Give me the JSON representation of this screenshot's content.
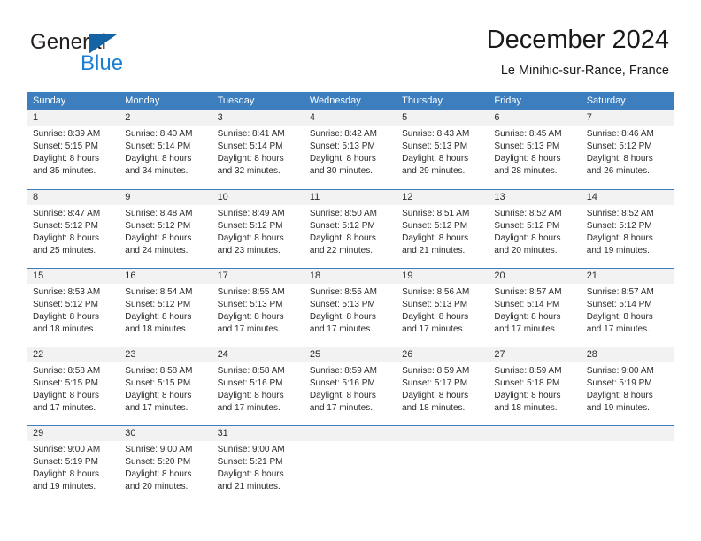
{
  "brand": {
    "word1": "General",
    "word2": "Blue",
    "triangle_color": "#1464a5",
    "word2_color": "#1a7fd4"
  },
  "header": {
    "title": "December 2024",
    "subtitle": "Le Minihic-sur-Rance, France"
  },
  "theme": {
    "header_blue": "#3d7ebe",
    "day_band_gray": "#f2f2f2",
    "text": "#2b2b2b"
  },
  "weekdays": [
    "Sunday",
    "Monday",
    "Tuesday",
    "Wednesday",
    "Thursday",
    "Friday",
    "Saturday"
  ],
  "weeks": [
    [
      {
        "day": "1",
        "lines": [
          "Sunrise: 8:39 AM",
          "Sunset: 5:15 PM",
          "Daylight: 8 hours",
          "and 35 minutes."
        ]
      },
      {
        "day": "2",
        "lines": [
          "Sunrise: 8:40 AM",
          "Sunset: 5:14 PM",
          "Daylight: 8 hours",
          "and 34 minutes."
        ]
      },
      {
        "day": "3",
        "lines": [
          "Sunrise: 8:41 AM",
          "Sunset: 5:14 PM",
          "Daylight: 8 hours",
          "and 32 minutes."
        ]
      },
      {
        "day": "4",
        "lines": [
          "Sunrise: 8:42 AM",
          "Sunset: 5:13 PM",
          "Daylight: 8 hours",
          "and 30 minutes."
        ]
      },
      {
        "day": "5",
        "lines": [
          "Sunrise: 8:43 AM",
          "Sunset: 5:13 PM",
          "Daylight: 8 hours",
          "and 29 minutes."
        ]
      },
      {
        "day": "6",
        "lines": [
          "Sunrise: 8:45 AM",
          "Sunset: 5:13 PM",
          "Daylight: 8 hours",
          "and 28 minutes."
        ]
      },
      {
        "day": "7",
        "lines": [
          "Sunrise: 8:46 AM",
          "Sunset: 5:12 PM",
          "Daylight: 8 hours",
          "and 26 minutes."
        ]
      }
    ],
    [
      {
        "day": "8",
        "lines": [
          "Sunrise: 8:47 AM",
          "Sunset: 5:12 PM",
          "Daylight: 8 hours",
          "and 25 minutes."
        ]
      },
      {
        "day": "9",
        "lines": [
          "Sunrise: 8:48 AM",
          "Sunset: 5:12 PM",
          "Daylight: 8 hours",
          "and 24 minutes."
        ]
      },
      {
        "day": "10",
        "lines": [
          "Sunrise: 8:49 AM",
          "Sunset: 5:12 PM",
          "Daylight: 8 hours",
          "and 23 minutes."
        ]
      },
      {
        "day": "11",
        "lines": [
          "Sunrise: 8:50 AM",
          "Sunset: 5:12 PM",
          "Daylight: 8 hours",
          "and 22 minutes."
        ]
      },
      {
        "day": "12",
        "lines": [
          "Sunrise: 8:51 AM",
          "Sunset: 5:12 PM",
          "Daylight: 8 hours",
          "and 21 minutes."
        ]
      },
      {
        "day": "13",
        "lines": [
          "Sunrise: 8:52 AM",
          "Sunset: 5:12 PM",
          "Daylight: 8 hours",
          "and 20 minutes."
        ]
      },
      {
        "day": "14",
        "lines": [
          "Sunrise: 8:52 AM",
          "Sunset: 5:12 PM",
          "Daylight: 8 hours",
          "and 19 minutes."
        ]
      }
    ],
    [
      {
        "day": "15",
        "lines": [
          "Sunrise: 8:53 AM",
          "Sunset: 5:12 PM",
          "Daylight: 8 hours",
          "and 18 minutes."
        ]
      },
      {
        "day": "16",
        "lines": [
          "Sunrise: 8:54 AM",
          "Sunset: 5:12 PM",
          "Daylight: 8 hours",
          "and 18 minutes."
        ]
      },
      {
        "day": "17",
        "lines": [
          "Sunrise: 8:55 AM",
          "Sunset: 5:13 PM",
          "Daylight: 8 hours",
          "and 17 minutes."
        ]
      },
      {
        "day": "18",
        "lines": [
          "Sunrise: 8:55 AM",
          "Sunset: 5:13 PM",
          "Daylight: 8 hours",
          "and 17 minutes."
        ]
      },
      {
        "day": "19",
        "lines": [
          "Sunrise: 8:56 AM",
          "Sunset: 5:13 PM",
          "Daylight: 8 hours",
          "and 17 minutes."
        ]
      },
      {
        "day": "20",
        "lines": [
          "Sunrise: 8:57 AM",
          "Sunset: 5:14 PM",
          "Daylight: 8 hours",
          "and 17 minutes."
        ]
      },
      {
        "day": "21",
        "lines": [
          "Sunrise: 8:57 AM",
          "Sunset: 5:14 PM",
          "Daylight: 8 hours",
          "and 17 minutes."
        ]
      }
    ],
    [
      {
        "day": "22",
        "lines": [
          "Sunrise: 8:58 AM",
          "Sunset: 5:15 PM",
          "Daylight: 8 hours",
          "and 17 minutes."
        ]
      },
      {
        "day": "23",
        "lines": [
          "Sunrise: 8:58 AM",
          "Sunset: 5:15 PM",
          "Daylight: 8 hours",
          "and 17 minutes."
        ]
      },
      {
        "day": "24",
        "lines": [
          "Sunrise: 8:58 AM",
          "Sunset: 5:16 PM",
          "Daylight: 8 hours",
          "and 17 minutes."
        ]
      },
      {
        "day": "25",
        "lines": [
          "Sunrise: 8:59 AM",
          "Sunset: 5:16 PM",
          "Daylight: 8 hours",
          "and 17 minutes."
        ]
      },
      {
        "day": "26",
        "lines": [
          "Sunrise: 8:59 AM",
          "Sunset: 5:17 PM",
          "Daylight: 8 hours",
          "and 18 minutes."
        ]
      },
      {
        "day": "27",
        "lines": [
          "Sunrise: 8:59 AM",
          "Sunset: 5:18 PM",
          "Daylight: 8 hours",
          "and 18 minutes."
        ]
      },
      {
        "day": "28",
        "lines": [
          "Sunrise: 9:00 AM",
          "Sunset: 5:19 PM",
          "Daylight: 8 hours",
          "and 19 minutes."
        ]
      }
    ],
    [
      {
        "day": "29",
        "lines": [
          "Sunrise: 9:00 AM",
          "Sunset: 5:19 PM",
          "Daylight: 8 hours",
          "and 19 minutes."
        ]
      },
      {
        "day": "30",
        "lines": [
          "Sunrise: 9:00 AM",
          "Sunset: 5:20 PM",
          "Daylight: 8 hours",
          "and 20 minutes."
        ]
      },
      {
        "day": "31",
        "lines": [
          "Sunrise: 9:00 AM",
          "Sunset: 5:21 PM",
          "Daylight: 8 hours",
          "and 21 minutes."
        ]
      },
      {
        "day": "",
        "lines": []
      },
      {
        "day": "",
        "lines": []
      },
      {
        "day": "",
        "lines": []
      },
      {
        "day": "",
        "lines": []
      }
    ]
  ]
}
